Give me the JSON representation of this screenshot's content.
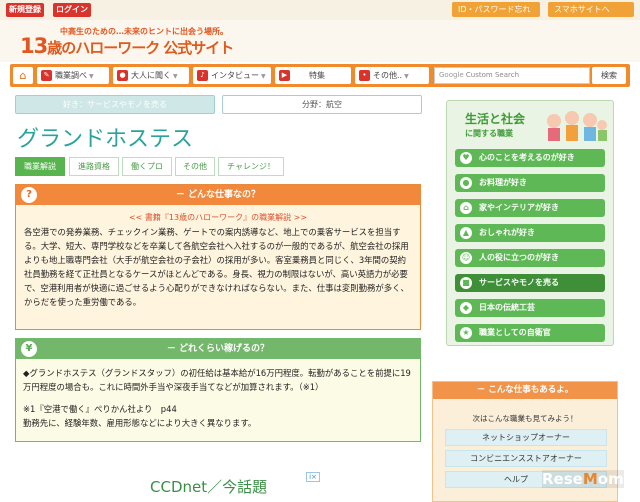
{
  "topbar": {
    "register": "新規登録",
    "login": "ログイン",
    "id_password": "ID・パスワード忘れ",
    "smartphone": "スマホサイトへ"
  },
  "logo": {
    "sub": "中高生のための…未来のヒントに出会う場所。",
    "number": "13",
    "rest": "歳のハローワーク",
    "official": "公式サイト"
  },
  "nav": {
    "items": [
      {
        "label": "職業調べ",
        "icon": "pencil-icon"
      },
      {
        "label": "大人に聞く",
        "icon": "speech-bubble-icon"
      },
      {
        "label": "インタビュー",
        "icon": "microphone-icon"
      },
      {
        "label": "特集",
        "icon": "flag-icon"
      },
      {
        "label": "その他..",
        "icon": "dots-icon"
      }
    ],
    "search_placeholder": "Custom Search",
    "search_brand": "Google",
    "search_button": "検索"
  },
  "tags": {
    "like": "好き：サービスやモノを売る",
    "field": "分野：航空"
  },
  "page_title": "グランドホステス",
  "tabs": [
    "職業解説",
    "進路資格",
    "働くプロ",
    "その他",
    "チャレンジ！"
  ],
  "panel_what": {
    "header": "－ どんな仕事なの？",
    "source": "<< 書籍『13歳のハローワーク』の職業解説 >>",
    "body": "各空港での発券業務、チェックイン業務、ゲートでの案内誘導など、地上での乗客サービスを担当する。大学、短大、専門学校などを卒業して各航空会社へ入社するのが一般的であるが、航空会社の採用よりも地上職専門会社（大手が航空会社の子会社）の採用が多い。客室乗務員と同じく、3年間の契約社員勤務を経て正社員となるケースがほとんどである。身長、視力の制限はないが、高い英語力が必要で、空港利用者が快適に過ごせるよう心配りができなければならない。また、仕事は変則勤務が多く、からだを使った重労働である。"
  },
  "panel_earn": {
    "header": "－ どれくらい稼げるの？",
    "body": "◆グランドホステス（グランドスタッフ）の初任給は基本給が16万円程度。転勤があることを前提に19万円程度の場合も。これに時間外手当や深夜手当てなどが加算されます。（※1）",
    "note1": "※1『空港で働く』ぺりかん社より　p44",
    "note2": "勤務先に、経験年数、雇用形態などにより大きく異なります。"
  },
  "ad": {
    "text": "CCDnet／今話題"
  },
  "sidebar": {
    "title": "生活と社会",
    "subtitle": "に関する職業",
    "items": [
      {
        "label": "心のことを考えるのが好き",
        "icon": "heart-icon"
      },
      {
        "label": "お料理が好き",
        "icon": "pot-icon"
      },
      {
        "label": "家やインテリアが好き",
        "icon": "house-icon"
      },
      {
        "label": "おしゃれが好き",
        "icon": "shirt-icon"
      },
      {
        "label": "人の役に立つのが好き",
        "icon": "people-icon"
      },
      {
        "label": "サービスやモノを売る",
        "icon": "shop-icon"
      },
      {
        "label": "日本の伝統工芸",
        "icon": "vase-icon"
      },
      {
        "label": "職業としての自衛官",
        "icon": "badge-icon"
      }
    ]
  },
  "related": {
    "header": "－ こんな仕事もあるよ。",
    "lead": "次はこんな職業も見てみよう！",
    "items": [
      "ネットショップオーナー",
      "コンビニエンスストアオーナー",
      "ヘルプ"
    ]
  },
  "watermark": {
    "pre": "Rese",
    "accent": "M",
    "post": "om"
  }
}
